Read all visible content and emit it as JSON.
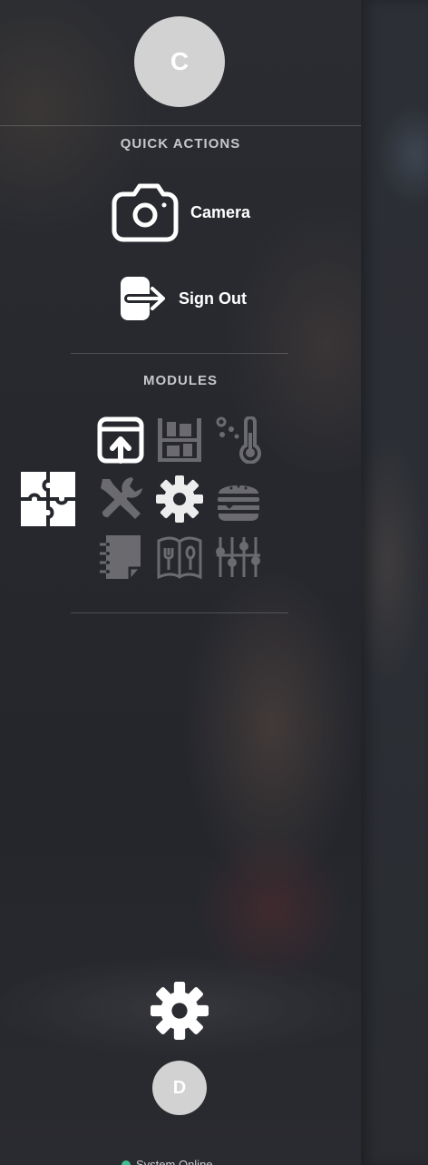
{
  "user": {
    "avatar_initial": "C"
  },
  "quick_actions": {
    "title": "QUICK ACTIONS",
    "items": [
      {
        "label": "Camera",
        "icon": "camera-icon"
      },
      {
        "label": "Sign Out",
        "icon": "sign-out-icon"
      }
    ]
  },
  "modules": {
    "title": "MODULES",
    "active_icon": "puzzle-icon",
    "items": [
      {
        "icon": "upload-window-icon",
        "state": "active"
      },
      {
        "icon": "shelving-icon",
        "state": "dim"
      },
      {
        "icon": "thermometer-icon",
        "state": "dim"
      },
      {
        "icon": "tools-icon",
        "state": "dim"
      },
      {
        "icon": "gear-icon",
        "state": "bright"
      },
      {
        "icon": "burger-icon",
        "state": "dim"
      },
      {
        "icon": "notebook-icon",
        "state": "dim"
      },
      {
        "icon": "menu-book-icon",
        "state": "dim"
      },
      {
        "icon": "sliders-icon",
        "state": "dim"
      }
    ]
  },
  "footer": {
    "settings_icon": "gear-icon",
    "avatar_initial": "D",
    "status_text": "System Online",
    "status_color": "#3fbf8f"
  },
  "colors": {
    "panel_bg": "#26282e",
    "icon_active": "#ffffff",
    "icon_dim": "#6b6b6f",
    "avatar_bg": "#d2d2d2"
  }
}
